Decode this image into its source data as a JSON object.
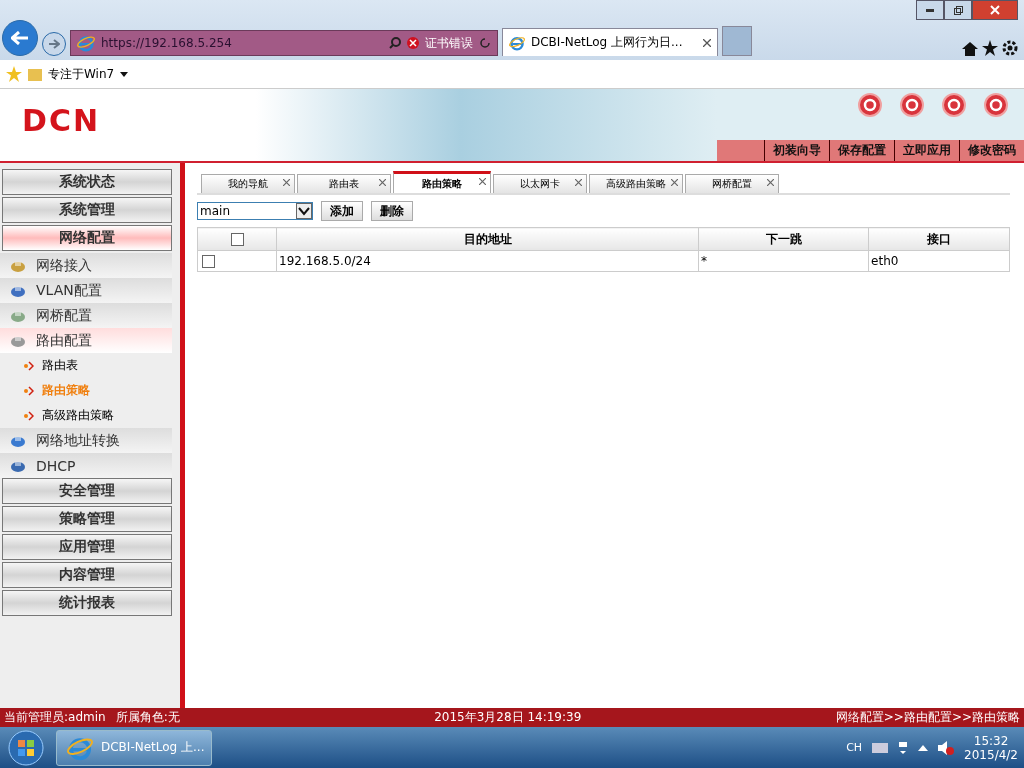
{
  "browser": {
    "address": "https://192.168.5.254",
    "cert_error": "证书错误",
    "tab_title": "DCBI-NetLog 上网行为日...",
    "favorites": [
      "专注于Win7"
    ]
  },
  "header": {
    "logo": "DCN",
    "links": [
      "初装向导",
      "保存配置",
      "立即应用",
      "修改密码"
    ]
  },
  "sidebar": [
    {
      "label": "系统状态",
      "selected": false
    },
    {
      "label": "系统管理",
      "selected": false
    },
    {
      "label": "网络配置",
      "selected": true,
      "children": [
        {
          "label": "网络接入",
          "selected": false
        },
        {
          "label": "VLAN配置",
          "selected": false
        },
        {
          "label": "网桥配置",
          "selected": false
        },
        {
          "label": "路由配置",
          "selected": true,
          "children": [
            {
              "label": "路由表",
              "selected": false
            },
            {
              "label": "路由策略",
              "selected": true
            },
            {
              "label": "高级路由策略",
              "selected": false
            }
          ]
        },
        {
          "label": "网络地址转换",
          "selected": false
        },
        {
          "label": "DHCP",
          "selected": false
        }
      ]
    },
    {
      "label": "安全管理",
      "selected": false
    },
    {
      "label": "策略管理",
      "selected": false
    },
    {
      "label": "应用管理",
      "selected": false
    },
    {
      "label": "内容管理",
      "selected": false
    },
    {
      "label": "统计报表",
      "selected": false
    }
  ],
  "tabs": [
    {
      "label": "我的导航",
      "selected": false
    },
    {
      "label": "路由表",
      "selected": false
    },
    {
      "label": "路由策略",
      "selected": true
    },
    {
      "label": "以太网卡",
      "selected": false
    },
    {
      "label": "高级路由策略",
      "selected": false
    },
    {
      "label": "网桥配置",
      "selected": false
    }
  ],
  "toolbar": {
    "table_select": "main",
    "buttons": [
      "添加",
      "删除"
    ]
  },
  "table": {
    "columns": [
      "目的地址",
      "下一跳",
      "接口"
    ],
    "header_checked": false,
    "rows": [
      {
        "checked": false,
        "cells": [
          "192.168.5.0/24",
          "*",
          "eth0"
        ]
      }
    ]
  },
  "status_bar": {
    "user": "当前管理员:admin",
    "role": "所属角色:无",
    "datetime": "2015年3月28日 14:19:39",
    "breadcrumb": "网络配置>>路由配置>>路由策略"
  },
  "taskbar": {
    "task": "DCBI-NetLog 上...",
    "lang": "CH",
    "time": "15:32",
    "date": "2015/4/2"
  }
}
